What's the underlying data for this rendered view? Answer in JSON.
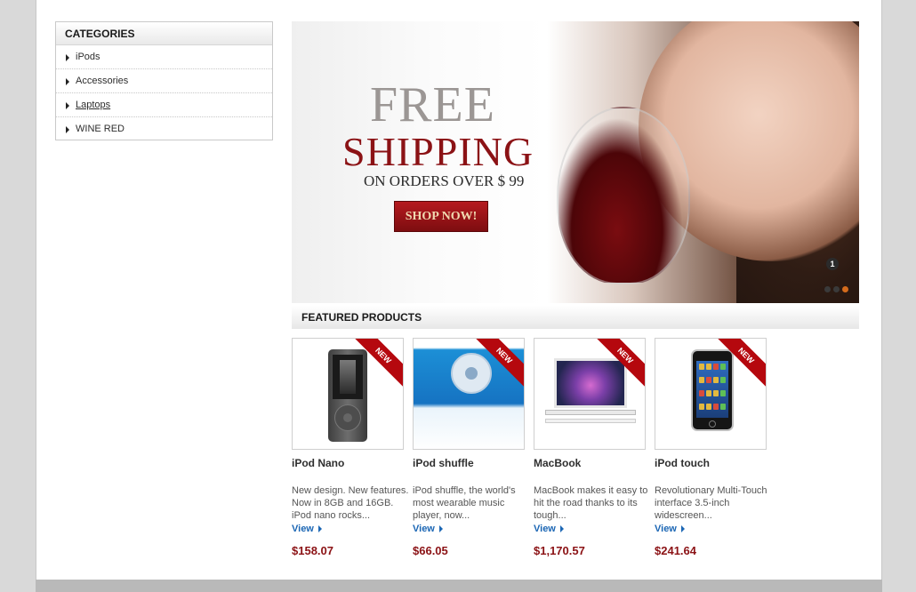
{
  "categories": {
    "title": "CATEGORIES",
    "items": [
      {
        "label": "iPods"
      },
      {
        "label": "Accessories"
      },
      {
        "label": "Laptops"
      },
      {
        "label": "WINE RED"
      }
    ]
  },
  "banner": {
    "line1": "FREE",
    "line2": "SHIPPING",
    "line3": "ON ORDERS OVER $ 99",
    "button_label": "SHOP NOW!",
    "slide_badge": "1",
    "slides_total": 3,
    "active_slide": 3
  },
  "featured": {
    "title": "FEATURED PRODUCTS",
    "badge": "NEW",
    "view_label": "View",
    "products": [
      {
        "name": "iPod Nano",
        "description": "New design. New features. Now in 8GB and 16GB. iPod nano rocks...",
        "price": "$158.07"
      },
      {
        "name": "iPod shuffle",
        "description": "iPod shuffle, the world's most wearable music player, now...",
        "price": "$66.05"
      },
      {
        "name": "MacBook",
        "description": "MacBook makes it easy to hit the road thanks to its tough...",
        "price": "$1,170.57"
      },
      {
        "name": "iPod touch",
        "description": "Revolutionary Multi-Touch interface 3.5-inch widescreen...",
        "price": "$241.64"
      }
    ]
  },
  "colors": {
    "accent_red": "#8b1215",
    "link_blue": "#1b66b4",
    "ribbon_red": "#b5080e"
  }
}
